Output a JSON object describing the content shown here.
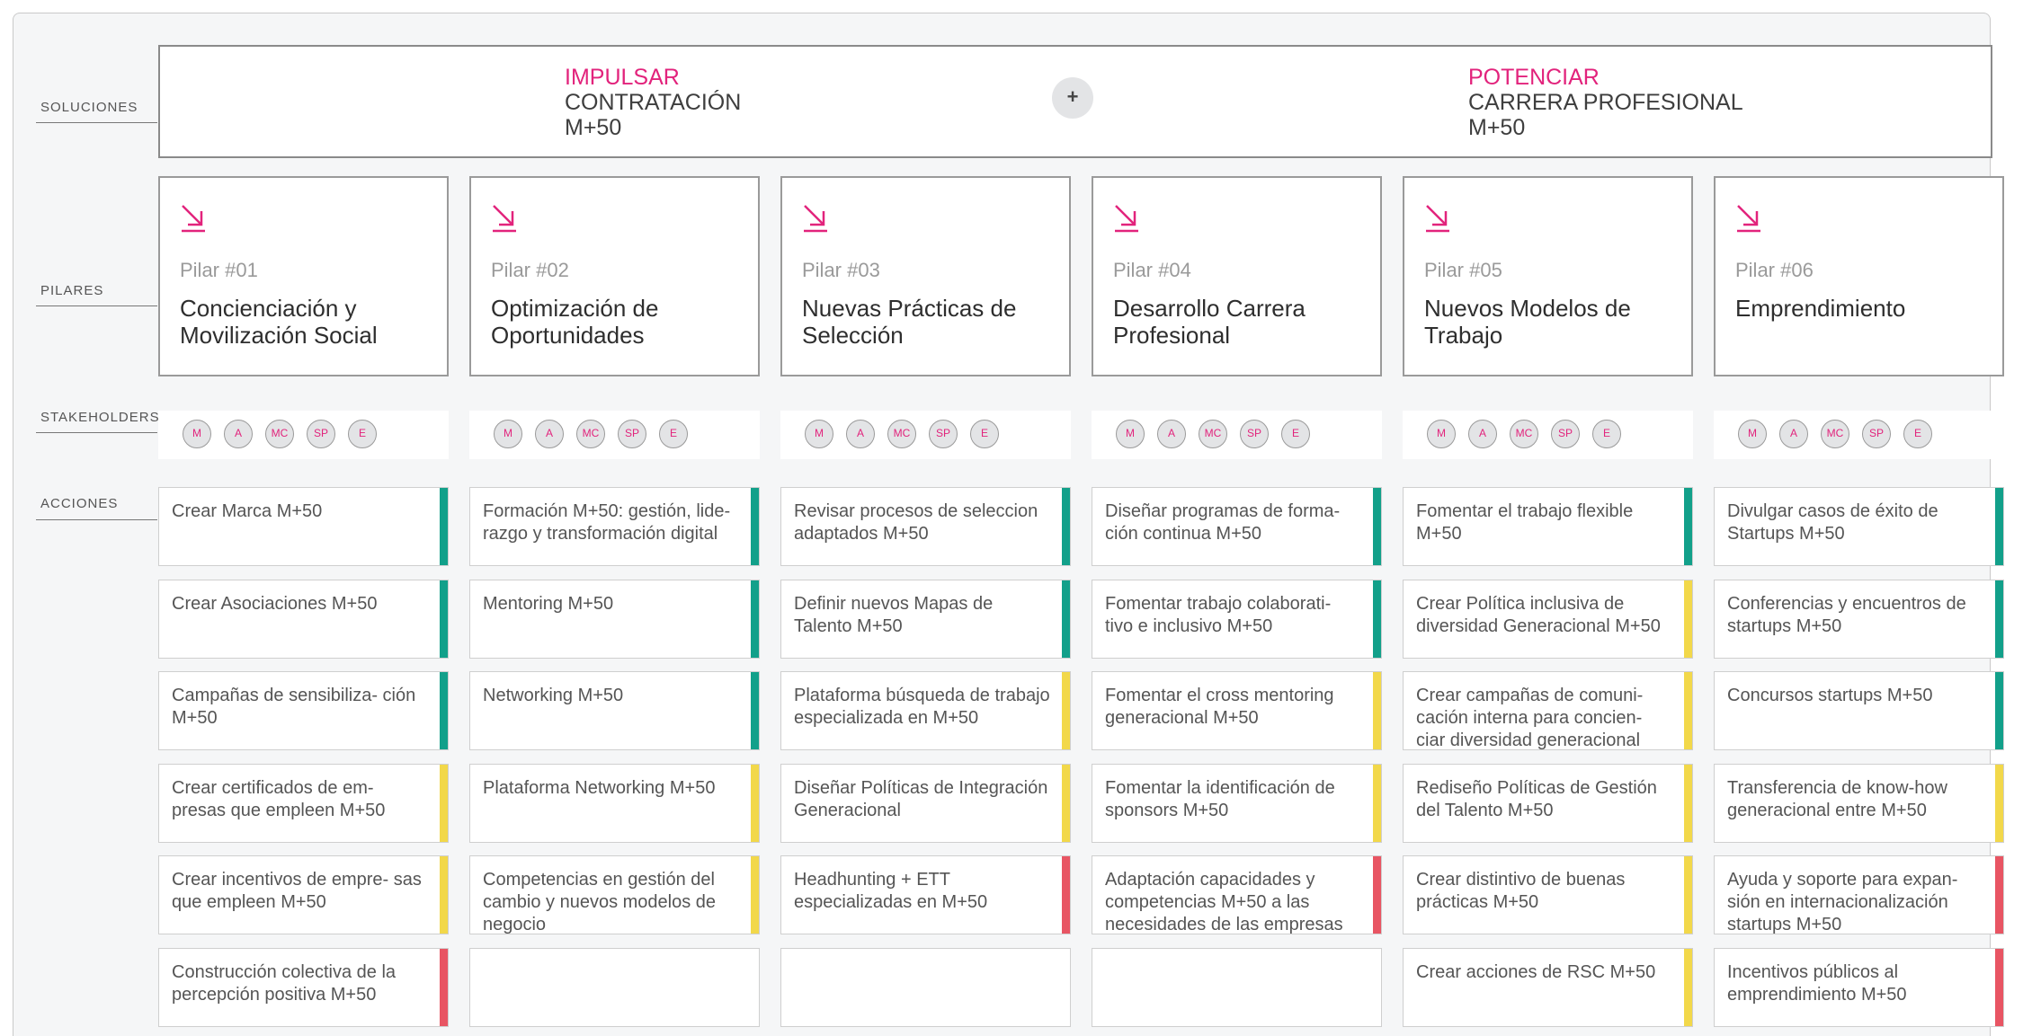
{
  "labels": {
    "soluciones": "SOLUCIONES",
    "pilares": "PILARES",
    "stakeholders": "STAKEHOLDERS",
    "acciones": "ACCIONES"
  },
  "solutions": {
    "left": {
      "verb": "IMPULSAR",
      "line1": "CONTRATACIÓN",
      "line2": "M+50"
    },
    "plus": "+",
    "right": {
      "verb": "POTENCIAR",
      "line1": "CARRERA PROFESIONAL",
      "line2": "M+50"
    }
  },
  "colors": {
    "accent": "#e2237c",
    "green": "#12a08a",
    "yellow": "#f2d84a",
    "red": "#e85563"
  },
  "pillars": [
    {
      "num": "Pilar #01",
      "title": "Concienciación y Movilización Social"
    },
    {
      "num": "Pilar #02",
      "title": "Optimización de Oportunidades"
    },
    {
      "num": "Pilar #03",
      "title": "Nuevas Prácticas de Selección"
    },
    {
      "num": "Pilar #04",
      "title": "Desarrollo Carrera Profesional"
    },
    {
      "num": "Pilar #05",
      "title": "Nuevos Modelos de Trabajo"
    },
    {
      "num": "Pilar #06",
      "title": "Emprendimiento"
    }
  ],
  "stakeholders": [
    "M",
    "A",
    "MC",
    "SP",
    "E"
  ],
  "actions": [
    [
      {
        "text": "Crear Marca M+50",
        "status": "green"
      },
      {
        "text": "Crear Asociaciones M+50",
        "status": "green"
      },
      {
        "text": "Campañas de sensibiliza- ción M+50",
        "status": "green"
      },
      {
        "text": "Crear certificados de em- presas que empleen M+50",
        "status": "yellow"
      },
      {
        "text": "Crear incentivos de empre- sas que empleen M+50",
        "status": "yellow"
      },
      {
        "text": "Construcción colectiva de la percepción positiva M+50",
        "status": "red"
      }
    ],
    [
      {
        "text": "Formación M+50: gestión, lide- razgo y transformación digital",
        "status": "green"
      },
      {
        "text": "Mentoring M+50",
        "status": "green"
      },
      {
        "text": "Networking M+50",
        "status": "green"
      },
      {
        "text": "Plataforma Networking M+50",
        "status": "yellow"
      },
      {
        "text": "Competencias en gestión del cambio y nuevos modelos de negocio",
        "status": "yellow"
      },
      {
        "text": "",
        "status": "none"
      }
    ],
    [
      {
        "text": "Revisar procesos de seleccion adaptados M+50",
        "status": "green"
      },
      {
        "text": "Definir nuevos Mapas de Talento M+50",
        "status": "green"
      },
      {
        "text": "Plataforma búsqueda de trabajo especializada en M+50",
        "status": "yellow"
      },
      {
        "text": "Diseñar Políticas de Integración Generacional",
        "status": "yellow"
      },
      {
        "text": "Headhunting + ETT especializadas en M+50",
        "status": "red"
      },
      {
        "text": "",
        "status": "none"
      }
    ],
    [
      {
        "text": "Diseñar programas de forma- ción continua M+50",
        "status": "green"
      },
      {
        "text": "Fomentar trabajo colaborati- tivo e inclusivo M+50",
        "status": "green"
      },
      {
        "text": "Fomentar el cross mentoring generacional M+50",
        "status": "yellow"
      },
      {
        "text": "Fomentar la identificación de sponsors M+50",
        "status": "yellow"
      },
      {
        "text": "Adaptación capacidades y competencias M+50 a las necesidades de las empresas",
        "status": "red"
      },
      {
        "text": "",
        "status": "none"
      }
    ],
    [
      {
        "text": "Fomentar el trabajo flexible M+50",
        "status": "green"
      },
      {
        "text": "Crear Política inclusiva de diversidad Generacional M+50",
        "status": "yellow"
      },
      {
        "text": "Crear campañas de comuni- cación interna para concien- ciar diversidad generacional",
        "status": "yellow"
      },
      {
        "text": "Rediseño Políticas de Gestión del Talento M+50",
        "status": "yellow"
      },
      {
        "text": "Crear distintivo de buenas prácticas M+50",
        "status": "yellow"
      },
      {
        "text": "Crear acciones de RSC M+50",
        "status": "yellow"
      }
    ],
    [
      {
        "text": "Divulgar casos de éxito de Startups M+50",
        "status": "green"
      },
      {
        "text": "Conferencias y encuentros de startups M+50",
        "status": "green"
      },
      {
        "text": "Concursos startups M+50",
        "status": "green"
      },
      {
        "text": "Transferencia de know-how generacional entre M+50",
        "status": "yellow"
      },
      {
        "text": "Ayuda y soporte para expan- sión en internacionalización startups M+50",
        "status": "red"
      },
      {
        "text": "Incentivos públicos al emprendimiento M+50",
        "status": "red"
      }
    ]
  ]
}
